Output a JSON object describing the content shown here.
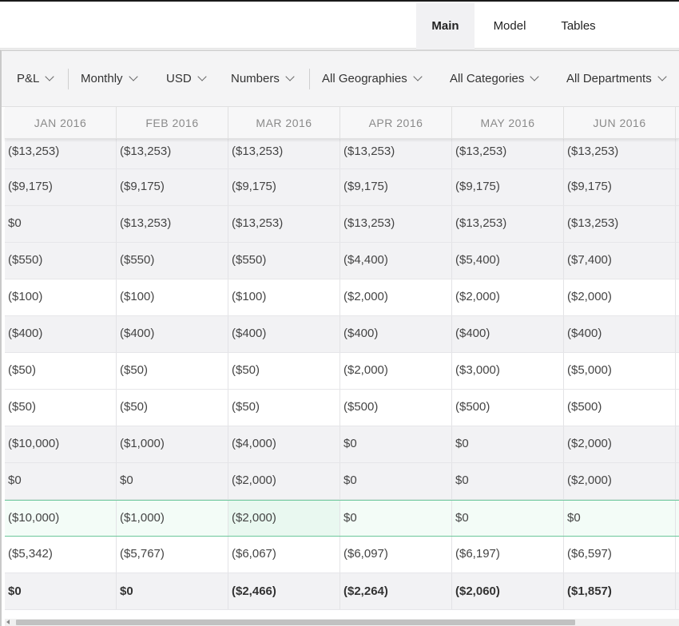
{
  "nav": {
    "tabs": [
      "Main",
      "Model",
      "Tables"
    ],
    "active": "Main"
  },
  "filters": [
    {
      "label": "P&L"
    },
    {
      "label": "Monthly"
    },
    {
      "label": "USD"
    },
    {
      "label": "Numbers"
    },
    {
      "label": "All Geographies"
    },
    {
      "label": "All Categories"
    },
    {
      "label": "All Departments"
    }
  ],
  "columns": [
    "JAN 2016",
    "FEB 2016",
    "MAR 2016",
    "APR 2016",
    "MAY 2016",
    "JUN 2016"
  ],
  "rows": [
    [
      "($13,253)",
      "($13,253)",
      "($13,253)",
      "($13,253)",
      "($13,253)",
      "($13,253)"
    ],
    [
      "($9,175)",
      "($9,175)",
      "($9,175)",
      "($9,175)",
      "($9,175)",
      "($9,175)"
    ],
    [
      "$0",
      "($13,253)",
      "($13,253)",
      "($13,253)",
      "($13,253)",
      "($13,253)"
    ],
    [
      "($550)",
      "($550)",
      "($550)",
      "($4,400)",
      "($5,400)",
      "($7,400)"
    ],
    [
      "($100)",
      "($100)",
      "($100)",
      "($2,000)",
      "($2,000)",
      "($2,000)"
    ],
    [
      "($400)",
      "($400)",
      "($400)",
      "($400)",
      "($400)",
      "($400)"
    ],
    [
      "($50)",
      "($50)",
      "($50)",
      "($2,000)",
      "($3,000)",
      "($5,000)"
    ],
    [
      "($50)",
      "($50)",
      "($50)",
      "($500)",
      "($500)",
      "($500)"
    ],
    [
      "($10,000)",
      "($1,000)",
      "($4,000)",
      "$0",
      "$0",
      "($2,000)"
    ],
    [
      "$0",
      "$0",
      "($2,000)",
      "$0",
      "$0",
      "($2,000)"
    ],
    [
      "($10,000)",
      "($1,000)",
      "($2,000)",
      "$0",
      "$0",
      "$0"
    ],
    [
      "($5,342)",
      "($5,767)",
      "($6,067)",
      "($6,097)",
      "($6,197)",
      "($6,597)"
    ],
    [
      "$0",
      "$0",
      "($2,466)",
      "($2,264)",
      "($2,060)",
      "($1,857)"
    ]
  ]
}
